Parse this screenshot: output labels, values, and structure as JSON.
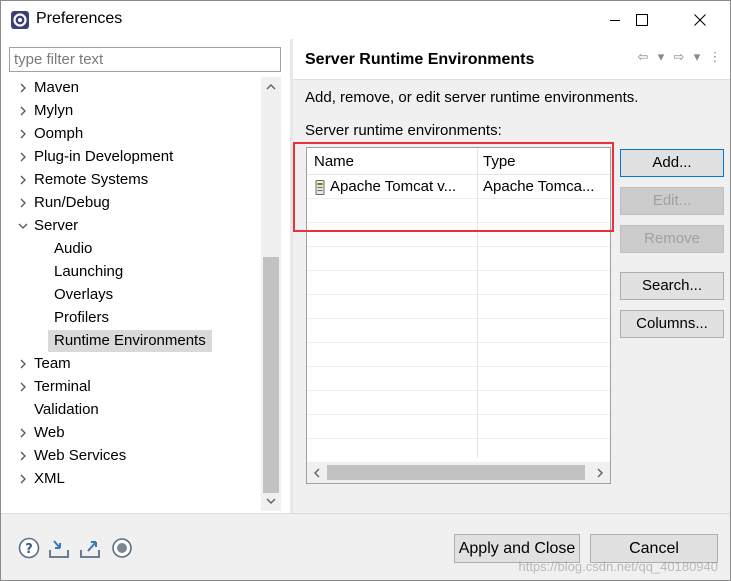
{
  "window": {
    "title": "Preferences",
    "app_icon": "eclipse-gear-icon",
    "controls": [
      "minimize-icon",
      "maximize-icon",
      "close-icon"
    ]
  },
  "filter": {
    "placeholder": "type filter text",
    "value": ""
  },
  "tree": {
    "items": [
      {
        "label": "Maven",
        "expander": "collapsed"
      },
      {
        "label": "Mylyn",
        "expander": "collapsed"
      },
      {
        "label": "Oomph",
        "expander": "collapsed"
      },
      {
        "label": "Plug-in Development",
        "expander": "collapsed"
      },
      {
        "label": "Remote Systems",
        "expander": "collapsed"
      },
      {
        "label": "Run/Debug",
        "expander": "collapsed"
      },
      {
        "label": "Server",
        "expander": "expanded"
      },
      {
        "label": "Audio",
        "expander": "none"
      },
      {
        "label": "Launching",
        "expander": "none"
      },
      {
        "label": "Overlays",
        "expander": "none"
      },
      {
        "label": "Profilers",
        "expander": "none"
      },
      {
        "label": "Runtime Environments",
        "expander": "none",
        "selected": true
      },
      {
        "label": "Team",
        "expander": "collapsed"
      },
      {
        "label": "Terminal",
        "expander": "collapsed"
      },
      {
        "label": "Validation",
        "expander": "none"
      },
      {
        "label": "Web",
        "expander": "collapsed"
      },
      {
        "label": "Web Services",
        "expander": "collapsed"
      },
      {
        "label": "XML",
        "expander": "collapsed"
      }
    ]
  },
  "page": {
    "title": "Server Runtime Environments",
    "description": "Add, remove, or edit server runtime environments.",
    "list_label": "Server runtime environments:",
    "nav_icons": [
      "back-arrow-icon",
      "dropdown-icon",
      "forward-arrow-icon",
      "dropdown-icon",
      "menu-dots-icon"
    ]
  },
  "table": {
    "columns": [
      "Name",
      "Type"
    ],
    "rows": [
      {
        "icon": "server-runtime-icon",
        "name": "Apache Tomcat v...",
        "type": "Apache Tomca..."
      }
    ]
  },
  "buttons": {
    "add": "Add...",
    "edit": "Edit...",
    "remove": "Remove",
    "search": "Search...",
    "columns": "Columns..."
  },
  "footer": {
    "icons": [
      "help-icon",
      "import-icon",
      "export-icon",
      "record-icon"
    ],
    "apply_close": "Apply and Close",
    "cancel": "Cancel",
    "watermark": "https://blog.csdn.net/qq_40180940"
  },
  "colors": {
    "highlight": "#e8313a",
    "selection": "#d9d9d9",
    "default_button_border": "#0078d7"
  }
}
